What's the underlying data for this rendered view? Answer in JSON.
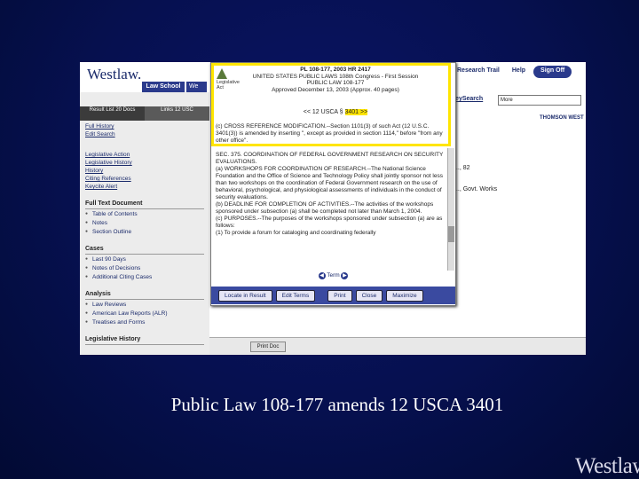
{
  "header": {
    "logo": "Westlaw.",
    "tabs": [
      "Law School",
      "We"
    ],
    "links": [
      "Research Trail",
      "Help",
      "Sign Off"
    ]
  },
  "left": {
    "tabs": [
      "Result List 20 Docs",
      "Links 12 USC"
    ],
    "top_links": [
      "Full History",
      "Edit Search"
    ],
    "history_links": [
      "Legislative Action",
      "Legislative History",
      "History",
      "Citing References",
      "Keycite Alert"
    ],
    "sections": [
      {
        "title": "Full Text Document",
        "items": [
          "Table of Contents",
          "Notes",
          "Section Outline"
        ]
      },
      {
        "title": "Cases",
        "items": [
          "Last 90 Days",
          "Notes of Decisions",
          "Additional Citing Cases"
        ]
      },
      {
        "title": "Analysis",
        "items": [
          "Law Reviews",
          "American Law Reports (ALR)",
          "Treatises and Forms"
        ]
      },
      {
        "title": "Legislative History",
        "items": []
      }
    ]
  },
  "main": {
    "search_label": "KeySearch",
    "search_value": "More",
    "thomson": "THOMSON WEST",
    "text1": "..., 82",
    "text2": "..., Govt. Works",
    "print_button": "Print Doc"
  },
  "popup": {
    "legis_label": "Legislative Act",
    "header_lines": [
      "PL 108-177, 2003 HR 2417",
      "UNITED STATES PUBLIC LAWS 108th Congress - First Session",
      "PUBLIC LAW 108-177",
      "Approved December 13, 2003 (Approx. 40 pages)"
    ],
    "usca_prefix": "<< 12 USCA § ",
    "usca_sel": "3401 >>",
    "subsec": "(c) CROSS REFERENCE MODIFICATION.--Section 1101(3) of such Act (12 U.S.C. 3401(3)) is amended by inserting \", except as provided in section 1114,\" before \"from any other office\".",
    "body": [
      "SEC. 375. COORDINATION OF FEDERAL GOVERNMENT RESEARCH ON SECURITY EVALUATIONS.",
      "(a) WORKSHOPS FOR COORDINATION OF RESEARCH.--The National Science Foundation and the Office of Science and Technology Policy shall jointly sponsor not less than two workshops on the coordination of Federal Government research on the use of behavioral, psychological, and physiological assessments of individuals in the conduct of security evaluations.",
      "(b) DEADLINE FOR COMPLETION OF ACTIVITIES.--The activities of the workshops sponsored under subsection (a) shall be completed not later than March 1, 2004.",
      "(c) PURPOSES.--The purposes of the workshops sponsored under subsection (a) are as follows:",
      "(1) To provide a forum for cataloging and coordinating federally"
    ],
    "pager": "Term",
    "buttons": [
      "Locate in Result",
      "Edit Terms",
      "Print",
      "Close",
      "Maximize"
    ]
  },
  "caption": "Public Law 108-177 amends 12 USCA 3401",
  "footer_logo": "Westlaw."
}
